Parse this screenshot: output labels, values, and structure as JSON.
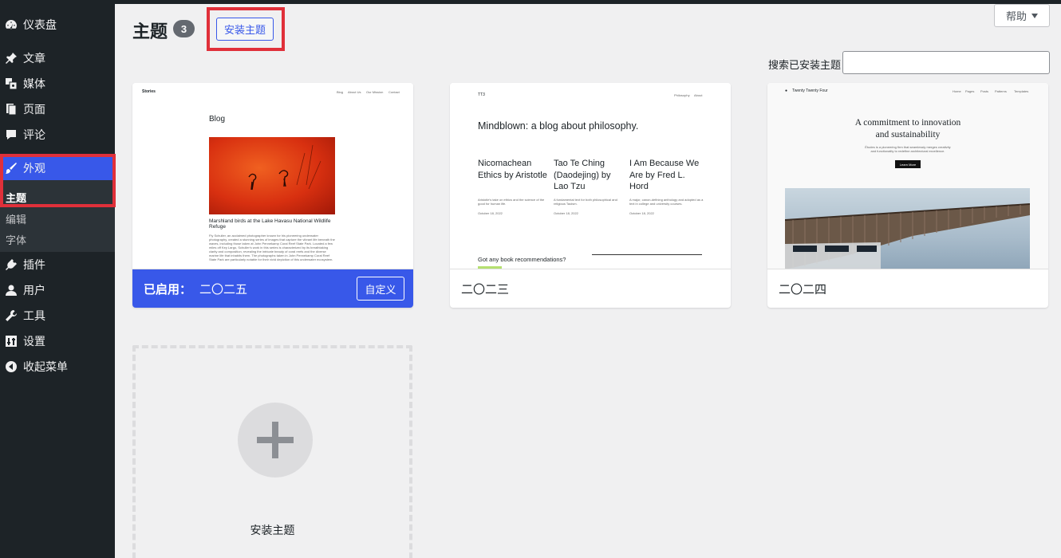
{
  "sidebar": {
    "items": [
      {
        "label": "仪表盘",
        "icon": "dashboard-icon"
      },
      {
        "label": "文章",
        "icon": "pin-icon"
      },
      {
        "label": "媒体",
        "icon": "media-icon"
      },
      {
        "label": "页面",
        "icon": "pages-icon"
      },
      {
        "label": "评论",
        "icon": "comment-icon"
      },
      {
        "label": "外观",
        "icon": "brush-icon"
      },
      {
        "label": "插件",
        "icon": "plugin-icon"
      },
      {
        "label": "用户",
        "icon": "user-icon"
      },
      {
        "label": "工具",
        "icon": "wrench-icon"
      },
      {
        "label": "设置",
        "icon": "settings-icon"
      },
      {
        "label": "收起菜单",
        "icon": "collapse-icon"
      }
    ],
    "submenu": [
      "主题",
      "编辑",
      "字体"
    ]
  },
  "header": {
    "title": "主题",
    "count": "3",
    "add_button": "安装主题",
    "help": "帮助",
    "search_label": "搜索已安装主题",
    "search_value": ""
  },
  "themes": [
    {
      "name": "二〇二五",
      "active_label": "已启用：",
      "customize": "自定义",
      "preview": {
        "site": "Stories",
        "nav": [
          "Blog",
          "About Us",
          "Our Mission",
          "Contact"
        ],
        "heading": "Blog",
        "caption": "Marshland birds at the Lake Havasu National Wildlife Refuge",
        "body": "Fly Schuller, an acclaimed photographer known for his pioneering underwater photography, created a stunning series of images that capture the vibrant life beneath the waves, including those taken at John Pennekamp Coral Reef State Park. Located a few miles off Key Largo, Schuller's work in this series is characterized by its breathtaking clarity and composition, revealing the intricate beauty of coral reefs and the diverse marine life that inhabits them. The photographs taken in John Pennekamp Coral Reef State Park are particularly notable for their vivid depiction of this underwater ecosystem."
      }
    },
    {
      "name": "二〇二三",
      "preview": {
        "site": "TT3",
        "nav": [
          "Philosophy",
          "About"
        ],
        "heading": "Mindblown: a blog about philosophy.",
        "posts": [
          {
            "title": "Nicomachean Ethics by Aristotle",
            "excerpt": "Aristotle's take on ethics and the science of the good for human life.",
            "date": "October 18, 2022"
          },
          {
            "title": "Tao Te Ching (Daodejing) by Lao Tzu",
            "excerpt": "A fundamental text for both philosophical and religious Taoism.",
            "date": "October 18, 2022"
          },
          {
            "title": "I Am Because We Are by Fred L. Hord",
            "excerpt": "A major, canon-defining anthology and adopted as a text in college and university courses.",
            "date": "October 18, 2022"
          }
        ],
        "cta": "Got any book recommendations?"
      }
    },
    {
      "name": "二〇二四",
      "preview": {
        "site": "Twenty Twenty Four",
        "nav": [
          "Home",
          "Pages",
          "Posts",
          "Patterns",
          "Templates"
        ],
        "heading_line1": "A commitment to innovation",
        "heading_line2": "and sustainability",
        "sub": "Études is a pioneering firm that seamlessly merges creativity and functionality to redefine architectural excellence.",
        "button": "Learn More"
      }
    }
  ],
  "add_new": {
    "label": "安装主题"
  },
  "colors": {
    "accent": "#3858e9",
    "sidebar": "#1d2327",
    "highlight": "#e0303a"
  }
}
